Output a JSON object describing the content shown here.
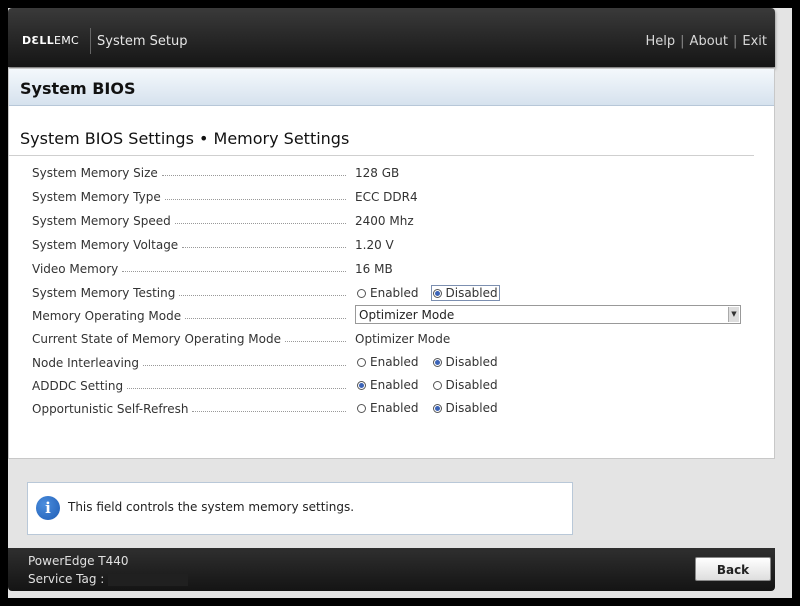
{
  "header": {
    "brand_main": "DƐLL",
    "brand_sub": "EMC",
    "app_title": "System Setup",
    "nav": [
      "Help",
      "About",
      "Exit"
    ]
  },
  "section": {
    "title": "System BIOS",
    "heading": "System BIOS Settings • Memory Settings"
  },
  "settings": [
    {
      "label": "System Memory Size",
      "value": "128 GB"
    },
    {
      "label": "System Memory Type",
      "value": "ECC DDR4"
    },
    {
      "label": "System Memory Speed",
      "value": "2400 Mhz"
    },
    {
      "label": "System Memory Voltage",
      "value": "1.20 V"
    },
    {
      "label": "Video Memory",
      "value": "16 MB"
    },
    {
      "label": "System Memory Testing",
      "options": [
        "Enabled",
        "Disabled"
      ],
      "selected": "Disabled"
    },
    {
      "label": "Memory Operating Mode",
      "value": "Optimizer Mode"
    },
    {
      "label": "Current State of Memory Operating Mode",
      "value": "Optimizer Mode"
    },
    {
      "label": "Node Interleaving",
      "options": [
        "Enabled",
        "Disabled"
      ],
      "selected": "Disabled"
    },
    {
      "label": "ADDDC Setting",
      "options": [
        "Enabled",
        "Disabled"
      ],
      "selected": "Enabled"
    },
    {
      "label": "Opportunistic Self-Refresh",
      "options": [
        "Enabled",
        "Disabled"
      ],
      "selected": "Disabled"
    }
  ],
  "help": {
    "icon": "info-icon",
    "text": "This field controls the system memory settings."
  },
  "footer": {
    "model": "PowerEdge T440",
    "service_tag_label": "Service Tag :",
    "back_label": "Back"
  },
  "colors": {
    "accent": "#3b63b7",
    "section_bar": "#d6e2ee",
    "header_bg": "#1e1e1e"
  }
}
